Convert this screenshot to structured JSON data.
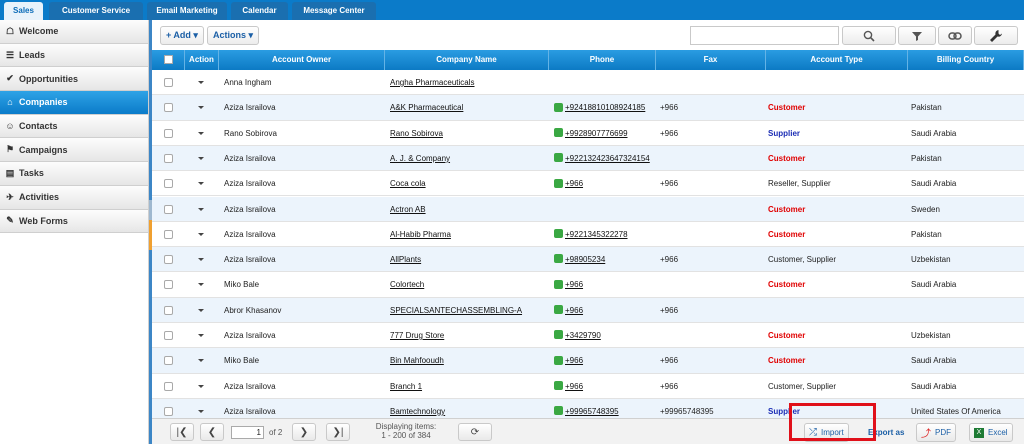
{
  "top_tabs": [
    "Sales",
    "Customer Service",
    "Email Marketing",
    "Calendar",
    "Message Center"
  ],
  "sidebar": {
    "items": [
      {
        "label": "Welcome",
        "icon": "home-icon"
      },
      {
        "label": "Leads",
        "icon": "leads-icon"
      },
      {
        "label": "Opportunities",
        "icon": "checkmark-icon"
      },
      {
        "label": "Companies",
        "icon": "building-icon"
      },
      {
        "label": "Contacts",
        "icon": "contacts-icon"
      },
      {
        "label": "Campaigns",
        "icon": "campaigns-icon"
      },
      {
        "label": "Tasks",
        "icon": "tasks-icon"
      },
      {
        "label": "Activities",
        "icon": "activities-icon"
      },
      {
        "label": "Web Forms",
        "icon": "web-forms-icon"
      }
    ],
    "active": "Companies"
  },
  "toolbar": {
    "add_label": "+ Add",
    "actions_label": "Actions",
    "search_placeholder": "",
    "icons": [
      "search-icon",
      "filter-icon",
      "link-icon",
      "wrench-icon"
    ]
  },
  "grid": {
    "columns": [
      "",
      "Action",
      "Account Owner",
      "Company Name",
      "Phone",
      "Fax",
      "Account Type",
      "Billing Country"
    ],
    "rows": [
      {
        "owner": "Anna Ingham",
        "company": "Angha Pharmaceuticals",
        "phone": "",
        "fax": "",
        "type": "",
        "country": ""
      },
      {
        "owner": "Aziza Israilova",
        "company": "A&K Pharmaceutical",
        "phone": "+92418810108924185",
        "fax": "+966",
        "type": "Customer",
        "country": "Pakistan"
      },
      {
        "owner": "Rano Sobirova",
        "company": "Rano Sobirova",
        "phone": "+9928907776699",
        "fax": "+966",
        "type": "Supplier",
        "country": "Saudi Arabia"
      },
      {
        "owner": "Aziza Israilova",
        "company": "A. J. & Company",
        "phone": "+922132423647324154",
        "fax": "",
        "type": "Customer",
        "country": "Pakistan"
      },
      {
        "owner": "Aziza Israilova",
        "company": "Coca cola",
        "phone": "+966",
        "fax": "+966",
        "type": "Reseller, Supplier",
        "country": "Saudi Arabia"
      },
      {
        "owner": "Aziza Israilova",
        "company": "Actron AB",
        "phone": "",
        "fax": "",
        "type": "Customer",
        "country": "Sweden"
      },
      {
        "owner": "Aziza Israilova",
        "company": "Al-Habib Pharma",
        "phone": "+9221345322278",
        "fax": "",
        "type": "Customer",
        "country": "Pakistan"
      },
      {
        "owner": "Aziza Israilova",
        "company": "AllPlants",
        "phone": "+98905234",
        "fax": "+966",
        "type": "Customer, Supplier",
        "country": "Uzbekistan"
      },
      {
        "owner": "Miko Bale",
        "company": "Colortech",
        "phone": "+966",
        "fax": "",
        "type": "Customer",
        "country": "Saudi Arabia"
      },
      {
        "owner": "Abror Khasanov",
        "company": "SPECIALSANTECHASSEMBLING-A",
        "phone": "+966",
        "fax": "+966",
        "type": "",
        "country": ""
      },
      {
        "owner": "Aziza Israilova",
        "company": "777 Drug Store",
        "phone": "+3429790",
        "fax": "",
        "type": "Customer",
        "country": "Uzbekistan"
      },
      {
        "owner": "Miko Bale",
        "company": "Bin Mahfooudh",
        "phone": "+966",
        "fax": "+966",
        "type": "Customer",
        "country": "Saudi Arabia"
      },
      {
        "owner": "Aziza Israilova",
        "company": "Branch 1",
        "phone": "+966",
        "fax": "+966",
        "type": "Customer, Supplier",
        "country": "Saudi Arabia"
      },
      {
        "owner": "Aziza Israilova",
        "company": "Bamtechnology",
        "phone": "+99965748395",
        "fax": "+99965748395",
        "type": "Supplier",
        "country": "United States Of America"
      }
    ]
  },
  "pager": {
    "page": "1",
    "of_label": "of",
    "total_pages": "2",
    "displaying_label": "Displaying items:",
    "displaying_range": "1 - 200 of 384",
    "import_label": "Import",
    "export_as_label": "Export as",
    "pdf_label": "PDF",
    "excel_label": "Excel"
  },
  "colors": {
    "accent": "#0b7bc9",
    "customer": "#e00000",
    "supplier": "#1b2db5",
    "highlight": "#e0101a"
  }
}
